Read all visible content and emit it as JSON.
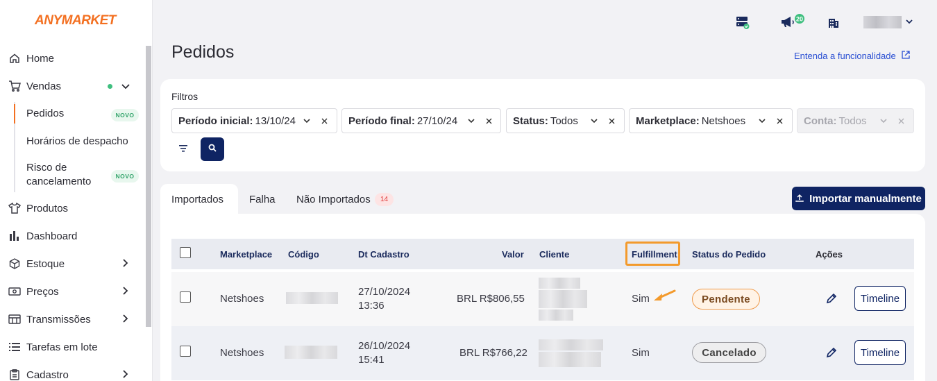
{
  "brand": {
    "logo_text": "ANYMARKET",
    "accent": "#f37021",
    "primary": "#0f2463"
  },
  "sidebar": {
    "items": [
      {
        "label": "Home",
        "icon": "home-icon"
      },
      {
        "label": "Vendas",
        "icon": "cart-icon"
      },
      {
        "label": "Produtos",
        "icon": "shirt-icon"
      },
      {
        "label": "Dashboard",
        "icon": "bar-chart-icon"
      },
      {
        "label": "Estoque",
        "icon": "box-icon"
      },
      {
        "label": "Preços",
        "icon": "cash-icon"
      },
      {
        "label": "Transmissões",
        "icon": "transmission-icon"
      },
      {
        "label": "Tarefas em lote",
        "icon": "list-icon"
      },
      {
        "label": "Cadastro",
        "icon": "clipboard-icon"
      }
    ],
    "sub_items": [
      {
        "label": "Pedidos",
        "badge": "NOVO"
      },
      {
        "label": "Horários de despacho"
      },
      {
        "label": "Risco de",
        "label2": "cancelamento",
        "badge": "NOVO"
      }
    ]
  },
  "topbar": {
    "notifications_count": "20"
  },
  "page": {
    "title": "Pedidos",
    "help_link": "Entenda a funcionalidade"
  },
  "filters": {
    "title": "Filtros",
    "chips": [
      {
        "key": "Período inicial:",
        "value": "13/10/24"
      },
      {
        "key": "Período final:",
        "value": "27/10/24"
      },
      {
        "key": "Status:",
        "value": "Todos"
      },
      {
        "key": "Marketplace:",
        "value": "Netshoes"
      },
      {
        "key": "Conta:",
        "value": "Todos"
      }
    ]
  },
  "tabs": [
    {
      "label": "Importados"
    },
    {
      "label": "Falha"
    },
    {
      "label": "Não Importados",
      "count": "14"
    }
  ],
  "import_button": "Importar manualmente",
  "table": {
    "headers": [
      "Marketplace",
      "Código",
      "Dt Cadastro",
      "Valor",
      "Cliente",
      "Fulfillment",
      "Status do Pedido",
      "Ações"
    ],
    "rows": [
      {
        "marketplace": "Netshoes",
        "date": "27/10/2024",
        "time": "13:36",
        "valor": "BRL R$806,55",
        "fulfillment": "Sim",
        "status": "Pendente",
        "action": "Timeline"
      },
      {
        "marketplace": "Netshoes",
        "date": "26/10/2024",
        "time": "15:41",
        "valor": "BRL R$766,22",
        "fulfillment": "Sim",
        "status": "Cancelado",
        "action": "Timeline"
      }
    ]
  }
}
